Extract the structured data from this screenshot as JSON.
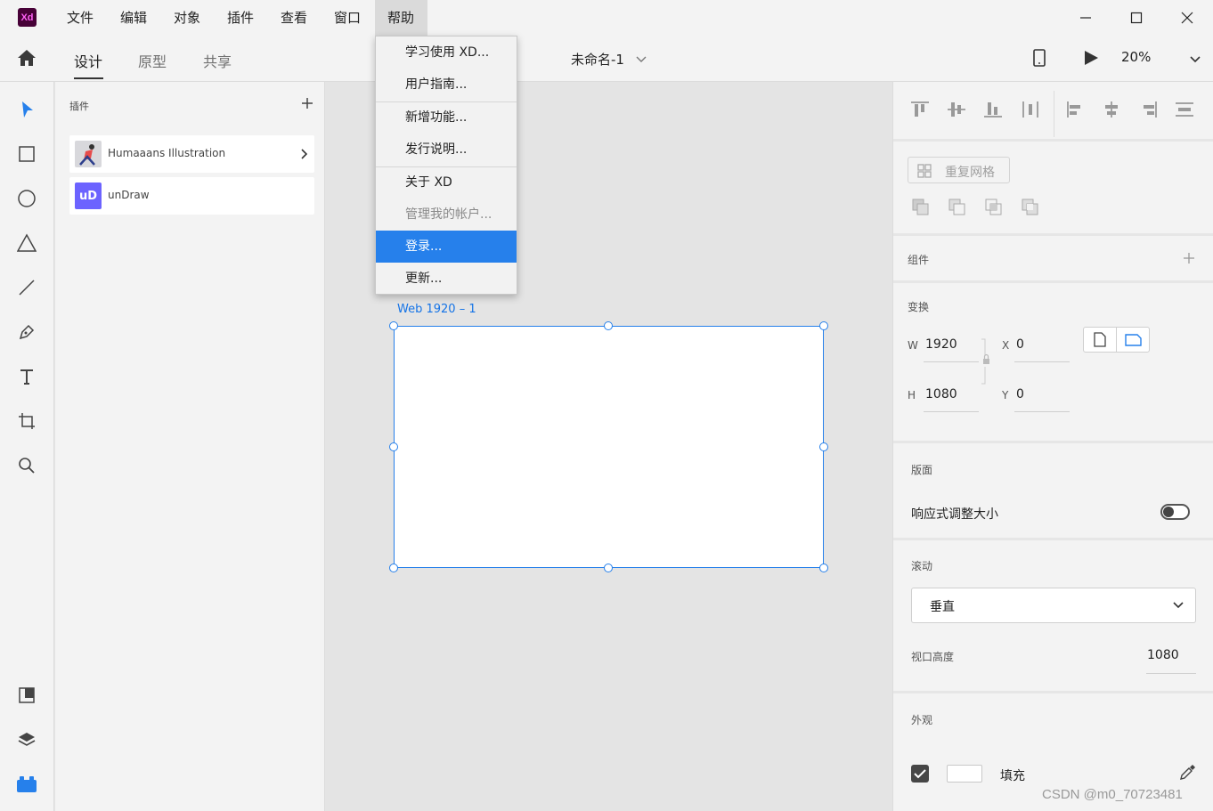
{
  "app": {
    "logo_text": "Xd"
  },
  "menubar": {
    "items": [
      "文件",
      "编辑",
      "对象",
      "插件",
      "查看",
      "窗口",
      "帮助"
    ],
    "active": "帮助"
  },
  "toolbar": {
    "tabs": [
      "设计",
      "原型",
      "共享"
    ],
    "active_tab": "设计",
    "doc_title": "未命名-1",
    "zoom": "20%"
  },
  "plugins": {
    "title": "插件",
    "items": [
      {
        "name": "Humaaans Illustration"
      },
      {
        "name": "unDraw",
        "thumb_text": "uD"
      }
    ]
  },
  "canvas": {
    "artboard_label": "Web 1920 – 1"
  },
  "help_menu": {
    "items": [
      {
        "label": "学习使用 XD..."
      },
      {
        "label": "用户指南..."
      },
      {
        "label": "新增功能..."
      },
      {
        "label": "发行说明..."
      },
      {
        "label": "关于 XD"
      },
      {
        "label": "管理我的帐户...",
        "disabled": true
      },
      {
        "label": "登录...",
        "highlighted": true
      },
      {
        "label": "更新..."
      }
    ]
  },
  "right_panel": {
    "repeat_grid": "重复网格",
    "components": "组件",
    "transform": {
      "title": "变换",
      "w_label": "W",
      "w": "1920",
      "h_label": "H",
      "h": "1080",
      "x_label": "X",
      "x": "0",
      "y_label": "Y",
      "y": "0"
    },
    "layout": {
      "title": "版面",
      "responsive": "响应式调整大小"
    },
    "scroll": {
      "title": "滚动",
      "value": "垂直",
      "viewport_label": "视口高度",
      "viewport_value": "1080"
    },
    "appearance": {
      "title": "外观",
      "fill": "填充"
    }
  },
  "watermark": "CSDN @m0_70723481",
  "colors": {
    "accent": "#2680eb",
    "logo_bg": "#470137",
    "logo_fg": "#ff61f6",
    "panel_bg": "#f3f3f3",
    "canvas_bg": "#e4e4e4"
  }
}
